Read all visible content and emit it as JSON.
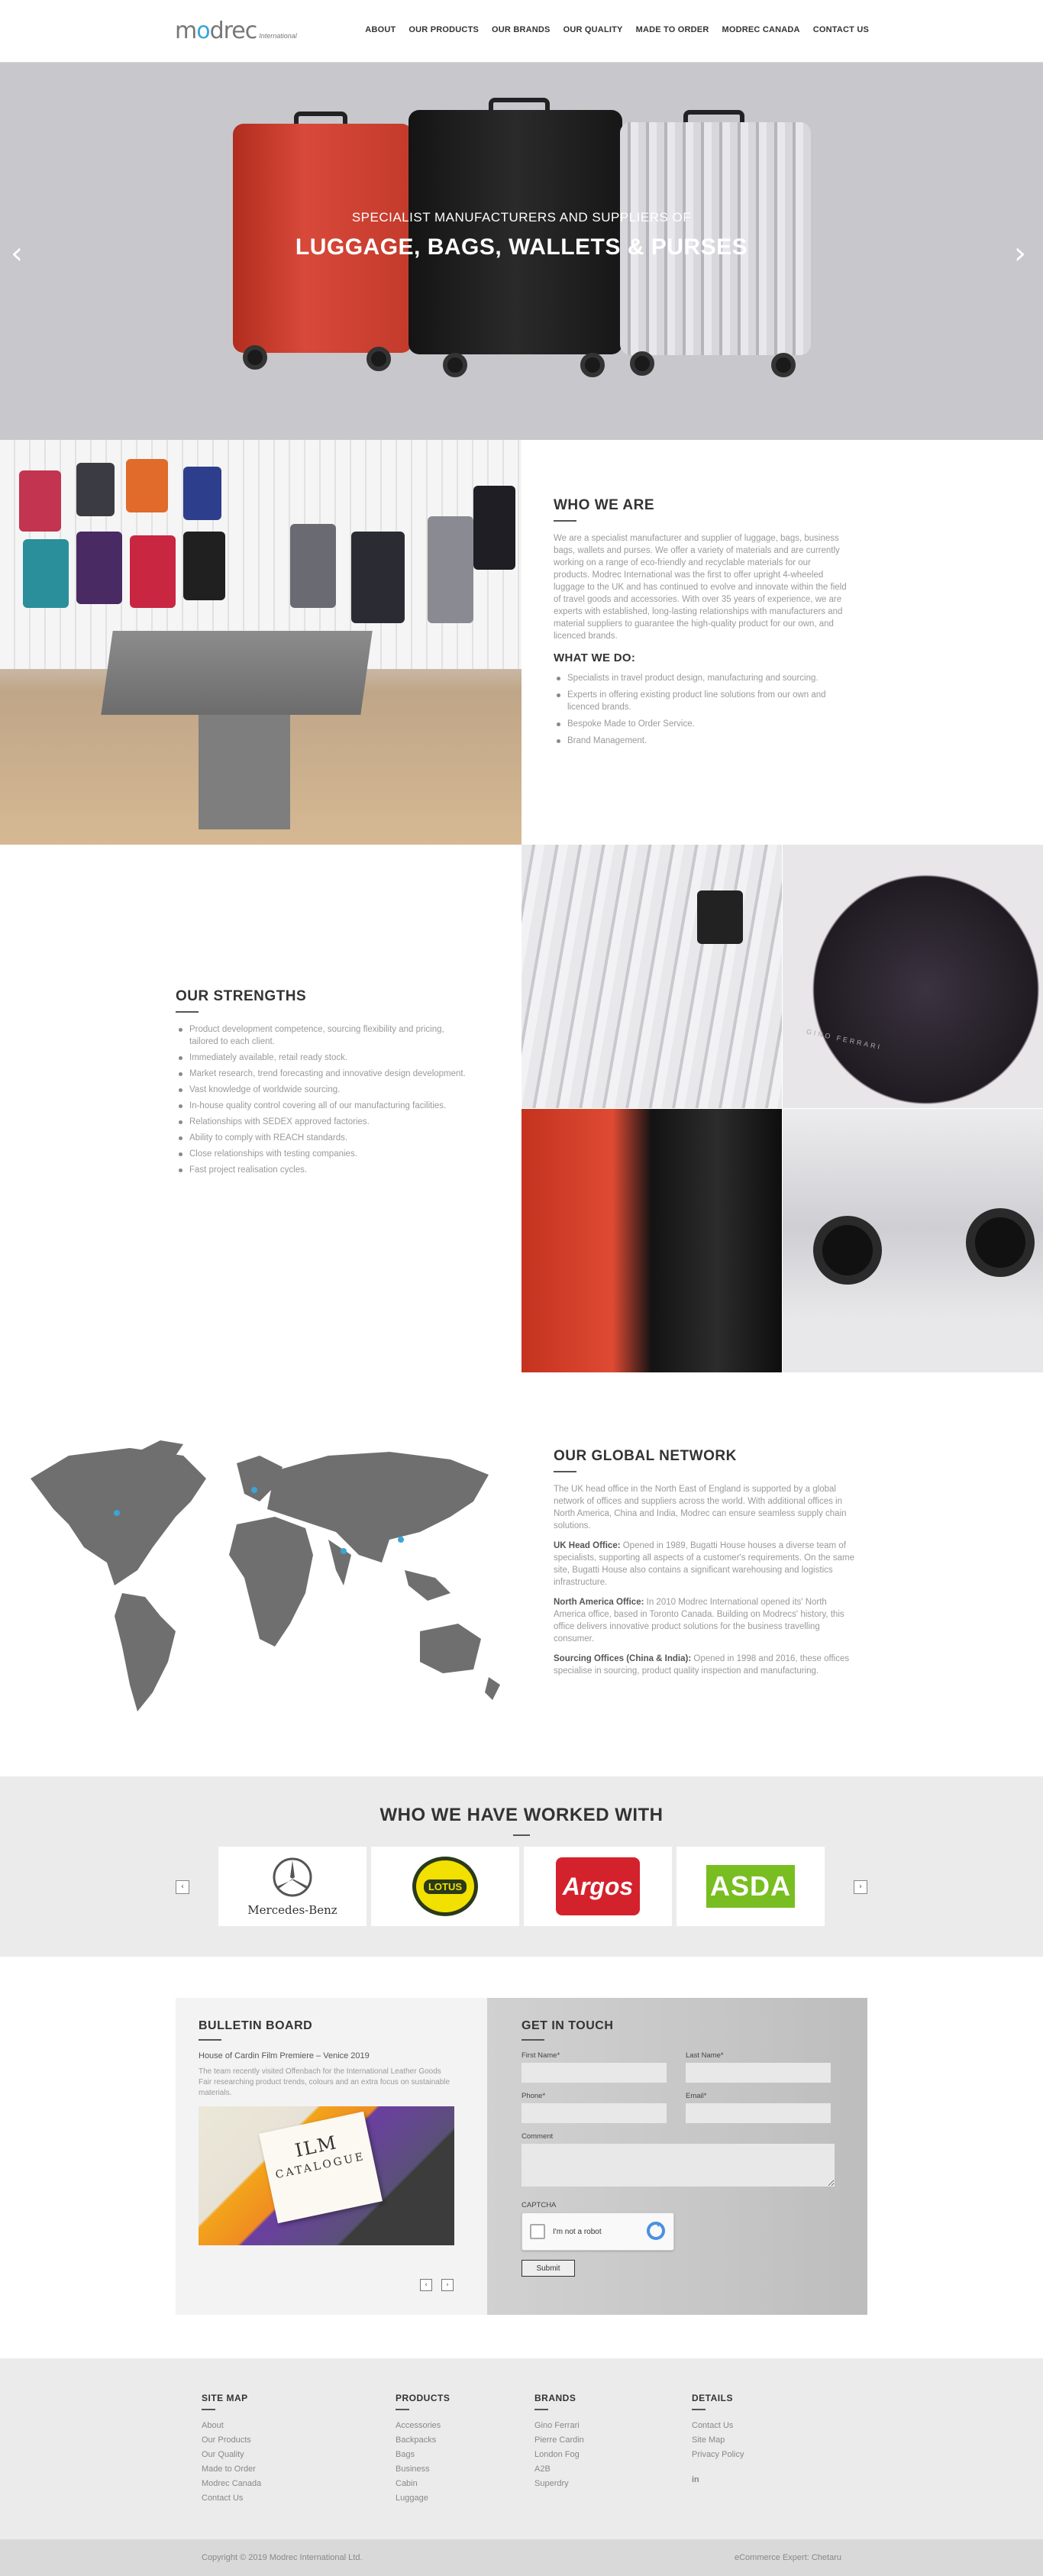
{
  "header": {
    "logo_main": "modrec",
    "logo_sub": "International",
    "nav": [
      "About",
      "Our Products",
      "Our Brands",
      "Our Quality",
      "Made to Order",
      "Modrec Canada",
      "Contact Us"
    ]
  },
  "hero": {
    "subtitle": "Specialist manufacturers and suppliers of",
    "title": "Luggage, Bags, Wallets & Purses",
    "prev": "‹",
    "next": "›"
  },
  "who": {
    "heading": "Who We Are",
    "text": "We are a specialist manufacturer and supplier of luggage, bags, business bags, wallets and purses. We offer a variety of materials and are currently working on a range of eco-friendly and recyclable materials for our products. Modrec International was the first to offer upright 4-wheeled luggage to the UK and has continued to evolve and innovate within the field of travel goods and accessories. With over 35 years of experience, we are experts with established, long-lasting relationships with manufacturers and material suppliers to guarantee the high-quality product for our own, and licenced brands.",
    "what_heading": "What We Do:",
    "what_items": [
      "Specialists in travel product design, manufacturing and sourcing.",
      "Experts in offering existing product line solutions from our own and licenced brands.",
      "Bespoke Made to Order Service.",
      "Brand Management."
    ]
  },
  "strengths": {
    "heading": "Our Strengths",
    "items": [
      "Product development competence, sourcing flexibility and pricing, tailored to each client.",
      "Immediately available, retail ready stock.",
      "Market research, trend forecasting and innovative design development.",
      "Vast knowledge of worldwide sourcing.",
      "In-house quality control covering all of our manufacturing facilities.",
      "Relationships with SEDEX approved factories.",
      "Ability to comply with REACH standards.",
      "Close relationships with testing companies.",
      "Fast project realisation cycles."
    ],
    "brand_label": "GINO FERRARI"
  },
  "global": {
    "heading": "Our Global Network",
    "intro": "The UK head office in the North East of England is supported by a global network of offices and suppliers across the world. With additional offices in North America, China and India, Modrec can ensure seamless supply chain solutions.",
    "uk_label": "UK Head Office:",
    "uk_text": " Opened in 1989, Bugatti House houses a diverse team of specialists, supporting all aspects of a customer's requirements. On the same site, Bugatti House also contains a significant warehousing and logistics infrastructure.",
    "na_label": "North America Office:",
    "na_text": " In 2010 Modrec International opened its' North America office, based in Toronto Canada. Building on Modrecs' history, this office delivers innovative product solutions for the business travelling consumer.",
    "so_label": "Sourcing Offices (China & India):",
    "so_text": " Opened in 1998 and 2016, these offices specialise in sourcing, product quality inspection and manufacturing."
  },
  "worked": {
    "heading": "Who We Have Worked With",
    "prev": "‹",
    "next": "›",
    "logos": [
      {
        "name": "Mercedes-Benz"
      },
      {
        "name": "LOTUS"
      },
      {
        "name": "Argos"
      },
      {
        "name": "ASDA"
      }
    ]
  },
  "bulletin": {
    "heading": "Bulletin Board",
    "post_title": "House of Cardin Film Premiere – Venice 2019",
    "post_text": "The team recently visited Offenbach for the International Leather Goods Fair researching product trends, colours and an extra focus on sustainable materials.",
    "catalog_a": "ILM",
    "catalog_b": "CATALOGUE",
    "prev": "‹",
    "next": "›"
  },
  "contact": {
    "heading": "Get In Touch",
    "first_name": "First Name*",
    "last_name": "Last Name*",
    "phone": "Phone*",
    "email": "Email*",
    "comment": "Comment",
    "captcha": "CAPTCHA",
    "robot": "I'm not a robot",
    "submit": "Submit"
  },
  "footer": {
    "sitemap_h": "Site Map",
    "sitemap": [
      "About",
      "Our Products",
      "Our Quality",
      "Made to Order",
      "Modrec Canada",
      "Contact Us"
    ],
    "products_h": "Products",
    "products": [
      "Accessories",
      "Backpacks",
      "Bags",
      "Business",
      "Cabin",
      "Luggage"
    ],
    "brands_h": "Brands",
    "brands": [
      "Gino Ferrari",
      "Pierre Cardin",
      "London Fog",
      "A2B",
      "Superdry"
    ],
    "details_h": "Details",
    "details": [
      "Contact Us",
      "Site Map",
      "Privacy Policy"
    ],
    "linkedin": "in",
    "copyright": "Copyright © 2019 Modrec International Ltd.",
    "credit": "eCommerce Expert: Chetaru"
  }
}
